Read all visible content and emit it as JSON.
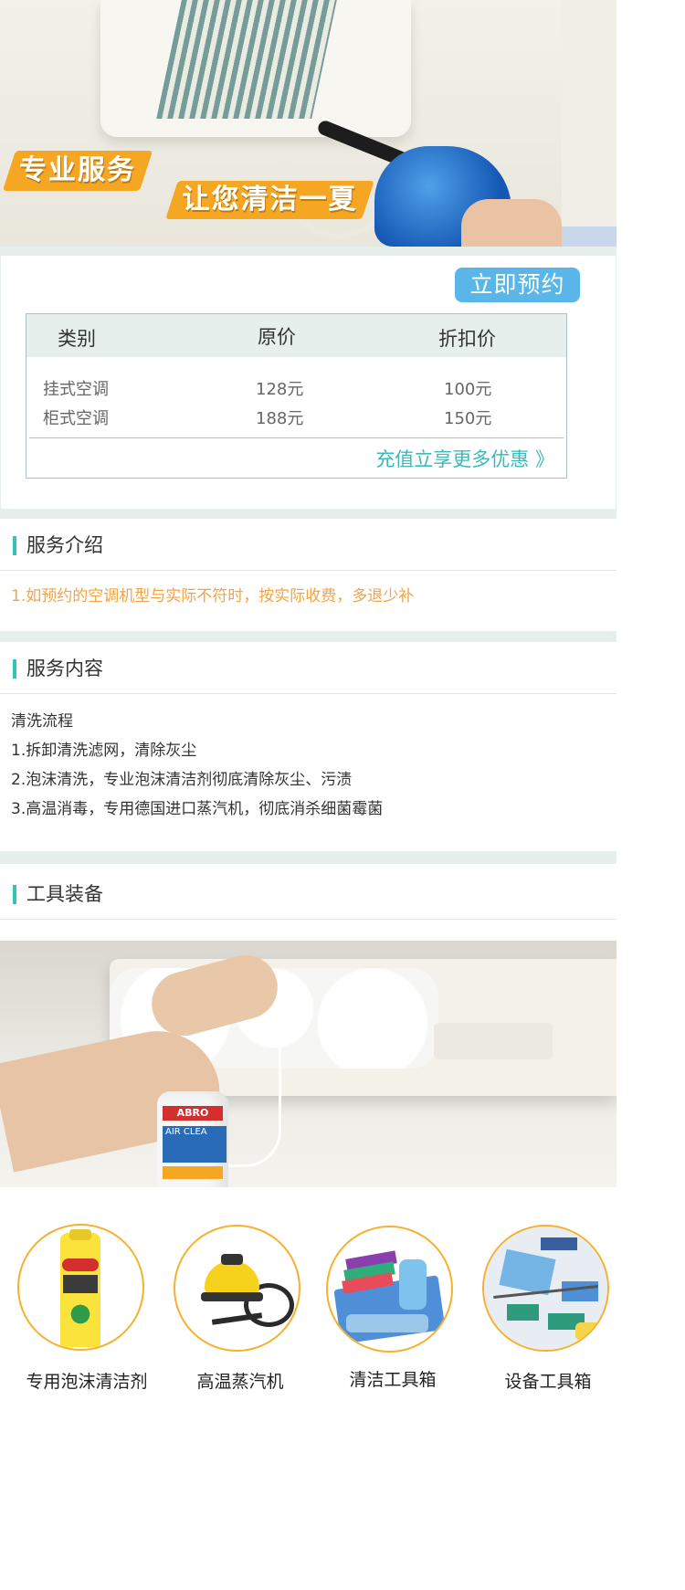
{
  "hero": {
    "slogan_left": "专业服务",
    "slogan_right": "让您清洁一夏"
  },
  "price": {
    "book_button": "立即预约",
    "headers": [
      "类别",
      "原价",
      "折扣价"
    ],
    "rows": [
      [
        "挂式空调",
        "128元",
        "100元"
      ],
      [
        "柜式空调",
        "188元",
        "150元"
      ]
    ],
    "promo_link": "充值立享更多优惠 》"
  },
  "intro": {
    "title": "服务介绍",
    "text": "1.如预约的空调机型与实际不符时，按实际收费，多退少补"
  },
  "content": {
    "title": "服务内容",
    "lines": [
      "清洗流程",
      "1.拆卸清洗滤网，清除灰尘",
      "2.泡沫清洗，专业泡沫清洁剂彻底清除灰尘、污渍",
      "3.高温消毒，专用德国进口蒸汽机，彻底消杀细菌霉菌"
    ]
  },
  "tools": {
    "title": "工具装备",
    "can_label_brand": "ABRO",
    "can_label_text": "AIR CLEA",
    "items": [
      {
        "label": "专用泡沫清洁剂",
        "icon": "foam-cleaner-image"
      },
      {
        "label": "高温蒸汽机",
        "icon": "steam-machine-image"
      },
      {
        "label": "清洁工具箱",
        "icon": "cleaning-toolbox-image"
      },
      {
        "label": "设备工具箱",
        "icon": "equipment-toolbox-image"
      }
    ]
  },
  "colors": {
    "accent_teal": "#35c3c0",
    "button_blue": "#5ab6e8",
    "orange": "#f5a623",
    "separator": "#e6efec"
  }
}
